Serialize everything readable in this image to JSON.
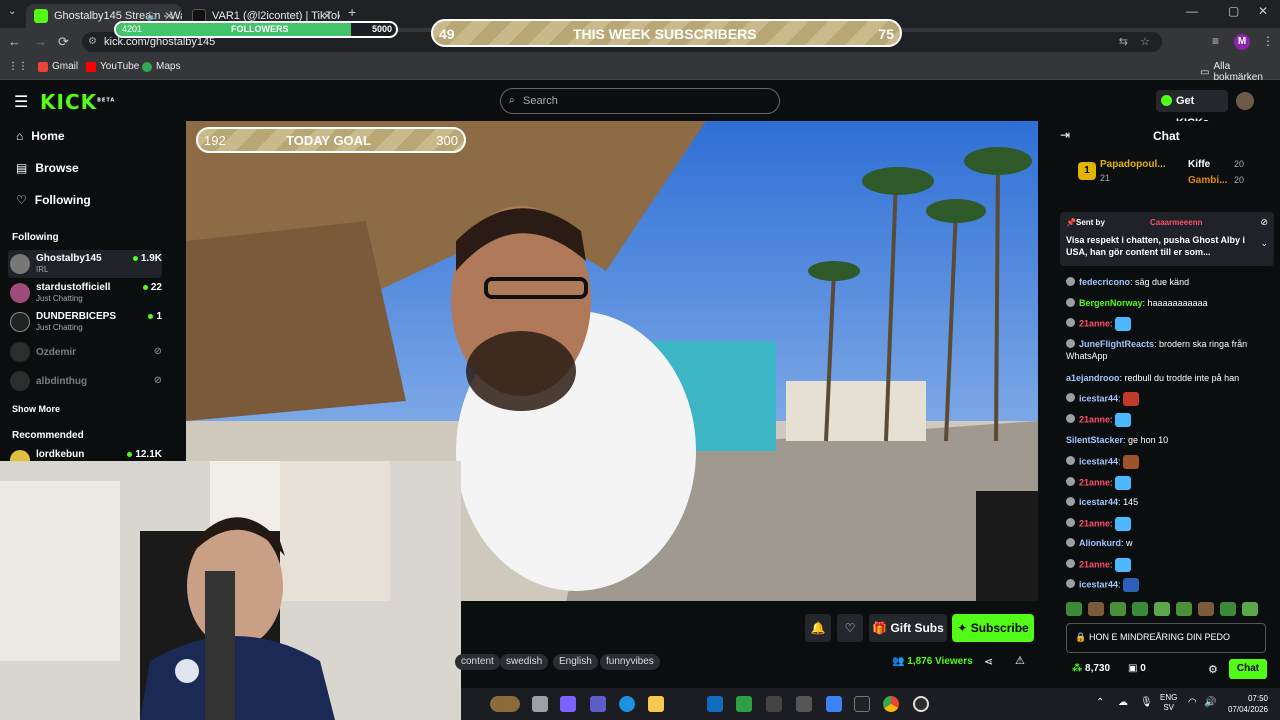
{
  "browser": {
    "tabs": [
      {
        "title": "Ghostalby145 Stream - Wa"
      },
      {
        "title": "VAR1 (@l2icontet) | TikTok"
      }
    ],
    "url": "kick.com/ghostalby145",
    "bookmarks": [
      "Gmail",
      "YouTube",
      "Maps"
    ],
    "all_bookmarks": "Alla bokmärken",
    "profile_initial": "M"
  },
  "overlays": {
    "followers": {
      "current": "4201",
      "label": "FOLLOWERS",
      "goal": "5000",
      "progress": 0.84
    },
    "subs_week": {
      "current": "49",
      "label": "THIS WEEK SUBSCRIBERS",
      "goal": "75"
    },
    "today_goal": {
      "current": "192",
      "label": "TODAY GOAL",
      "goal": "300"
    }
  },
  "kick": {
    "logo": "KICK",
    "logo_beta": "BETA",
    "search_placeholder": "Search",
    "get_kicks": "Get KICKs",
    "nav": [
      "Home",
      "Browse",
      "Following"
    ],
    "following_title": "Following",
    "following": [
      {
        "name": "Ghostalby145",
        "category": "IRL",
        "viewers": "1.9K",
        "live": true
      },
      {
        "name": "stardustofficiell",
        "category": "Just Chatting",
        "viewers": "22",
        "live": true
      },
      {
        "name": "DUNDERBICEPS",
        "category": "Just Chatting",
        "viewers": "1",
        "live": true
      },
      {
        "name": "Ozdemir",
        "category": "",
        "viewers": "",
        "live": false
      },
      {
        "name": "albdinthug",
        "category": "",
        "viewers": "",
        "live": false
      }
    ],
    "show_more": "Show More",
    "recommended_title": "Recommended",
    "recommended": [
      {
        "name": "lordkebun",
        "viewers": "12.1K"
      }
    ],
    "gift_subs": "Gift Subs",
    "subscribe": "Subscribe",
    "tags": [
      "content",
      "swedish",
      "English",
      "funnyvibes"
    ],
    "viewers": "1,876",
    "viewers_label": "Viewers"
  },
  "chat": {
    "title": "Chat",
    "leaderboard": [
      {
        "rank": "1",
        "name": "Papadopoul...",
        "count": "21"
      },
      {
        "name": "Kiffe",
        "count": "20"
      },
      {
        "name": "Gambi...",
        "count": "20"
      }
    ],
    "pinned": {
      "sent_by_label": "Sent by",
      "user": "Caaarmeeenn",
      "text": "Visa respekt i chatten, pusha Ghost Alby i USA, han gör content till er som..."
    },
    "messages": [
      {
        "user": "fedecricono",
        "color": "#a3c4ff",
        "text": "säg due känd"
      },
      {
        "user": "BergenNorway",
        "color": "#53fc18",
        "text": "haaaaaaaaaaa"
      },
      {
        "user": "21anne",
        "color": "#ff4d6d",
        "text": "",
        "emote": "#4db8ff"
      },
      {
        "user": "JuneFlightReacts",
        "color": "#a3c4ff",
        "text": "brodern ska ringa från WhatsApp"
      },
      {
        "user": "a1ejandrooo",
        "color": "#a3c4ff",
        "text": "redbull du trodde inte på han",
        "nobadge": true
      },
      {
        "user": "icestar44",
        "color": "#a3c4ff",
        "text": "",
        "emote": "#c0392b"
      },
      {
        "user": "21anne",
        "color": "#ff4d6d",
        "text": "",
        "emote": "#4db8ff"
      },
      {
        "user": "SilentStacker",
        "color": "#a3c4ff",
        "text": "ge hon 10",
        "nobadge": true
      },
      {
        "user": "icestar44",
        "color": "#a3c4ff",
        "text": "",
        "emote": "#a0522d"
      },
      {
        "user": "21anne",
        "color": "#ff4d6d",
        "text": "",
        "emote": "#4db8ff"
      },
      {
        "user": "icestar44",
        "color": "#a3c4ff",
        "text": "145"
      },
      {
        "user": "21anne",
        "color": "#ff4d6d",
        "text": "",
        "emote": "#4db8ff"
      },
      {
        "user": "Alionkurd",
        "color": "#a3c4ff",
        "text": "w"
      },
      {
        "user": "21anne",
        "color": "#ff4d6d",
        "text": "",
        "emote": "#4db8ff"
      },
      {
        "user": "icestar44",
        "color": "#a3c4ff",
        "text": "",
        "emote": "#2e5fb8"
      }
    ],
    "input_text": "HON E MINDREÅRING DIN PEDO",
    "kicks_balance": "8,730",
    "sub_count": "0",
    "chat_button": "Chat"
  },
  "taskbar": {
    "lang": "ENG",
    "region": "SV",
    "time": "07:50",
    "date": "07/04/2026"
  }
}
